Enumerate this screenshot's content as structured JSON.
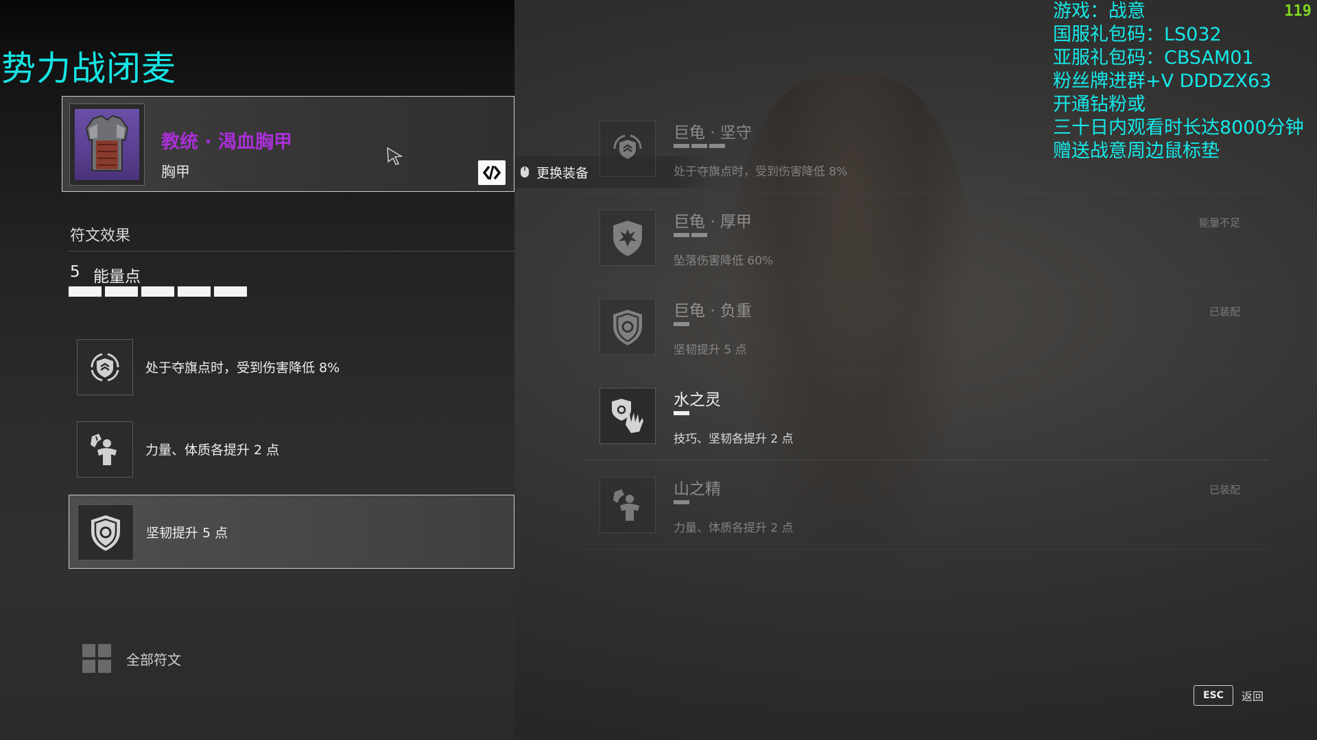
{
  "title": "势力战闭麦",
  "equipment": {
    "name": "教统 · 渴血胸甲",
    "type": "胸甲",
    "swap_label": "更换装备"
  },
  "rune_effects": {
    "heading": "符文效果",
    "energy_value": "5",
    "energy_label": "能量点",
    "energy_bars_filled": 5,
    "effects": [
      {
        "icon": "shield-flag-icon",
        "text": "处于夺旗点时，受到伤害降低 8%"
      },
      {
        "icon": "strength-icon",
        "text": "力量、体质各提升 2 点"
      },
      {
        "icon": "shield-circle-icon",
        "text": "坚韧提升 5 点"
      }
    ],
    "all_runes_label": "全部符文"
  },
  "rune_list": [
    {
      "name": "巨龟 · 坚守",
      "cost": 3,
      "desc": "处于夺旗点时，受到伤害降低 8%",
      "status": "",
      "icon": "shield-flag-icon",
      "dim": true
    },
    {
      "name": "巨龟 · 厚甲",
      "cost": 2,
      "desc": "坠落伤害降低 60%",
      "status": "能量不足",
      "icon": "shield-splash-icon",
      "dim": true
    },
    {
      "name": "巨龟 · 负重",
      "cost": 1,
      "desc": "坚韧提升 5 点",
      "status": "已装配",
      "icon": "shield-circle-icon",
      "dim": true
    },
    {
      "name": "水之灵",
      "cost": 1,
      "desc": "技巧、坚韧各提升 2 点",
      "status": "",
      "icon": "shield-hand-icon",
      "dim": false
    },
    {
      "name": "山之精",
      "cost": 1,
      "desc": "力量、体质各提升 2 点",
      "status": "已装配",
      "icon": "strength-icon",
      "dim": true
    }
  ],
  "overlay": {
    "lines": [
      "游戏：战意",
      "国服礼包码：LS032",
      "亚服礼包码：CBSAM01",
      "粉丝牌进群+V DDDZX63",
      "开通钻粉或",
      "三十日内观看时长达8000分钟",
      "赠送战意周边鼠标垫"
    ],
    "fps": "119"
  },
  "footer": {
    "esc_key": "ESC",
    "back_label": "返回"
  },
  "colors": {
    "title": "#17e4e4",
    "equip_name": "#a92fd8",
    "fps": "#7ed321"
  }
}
